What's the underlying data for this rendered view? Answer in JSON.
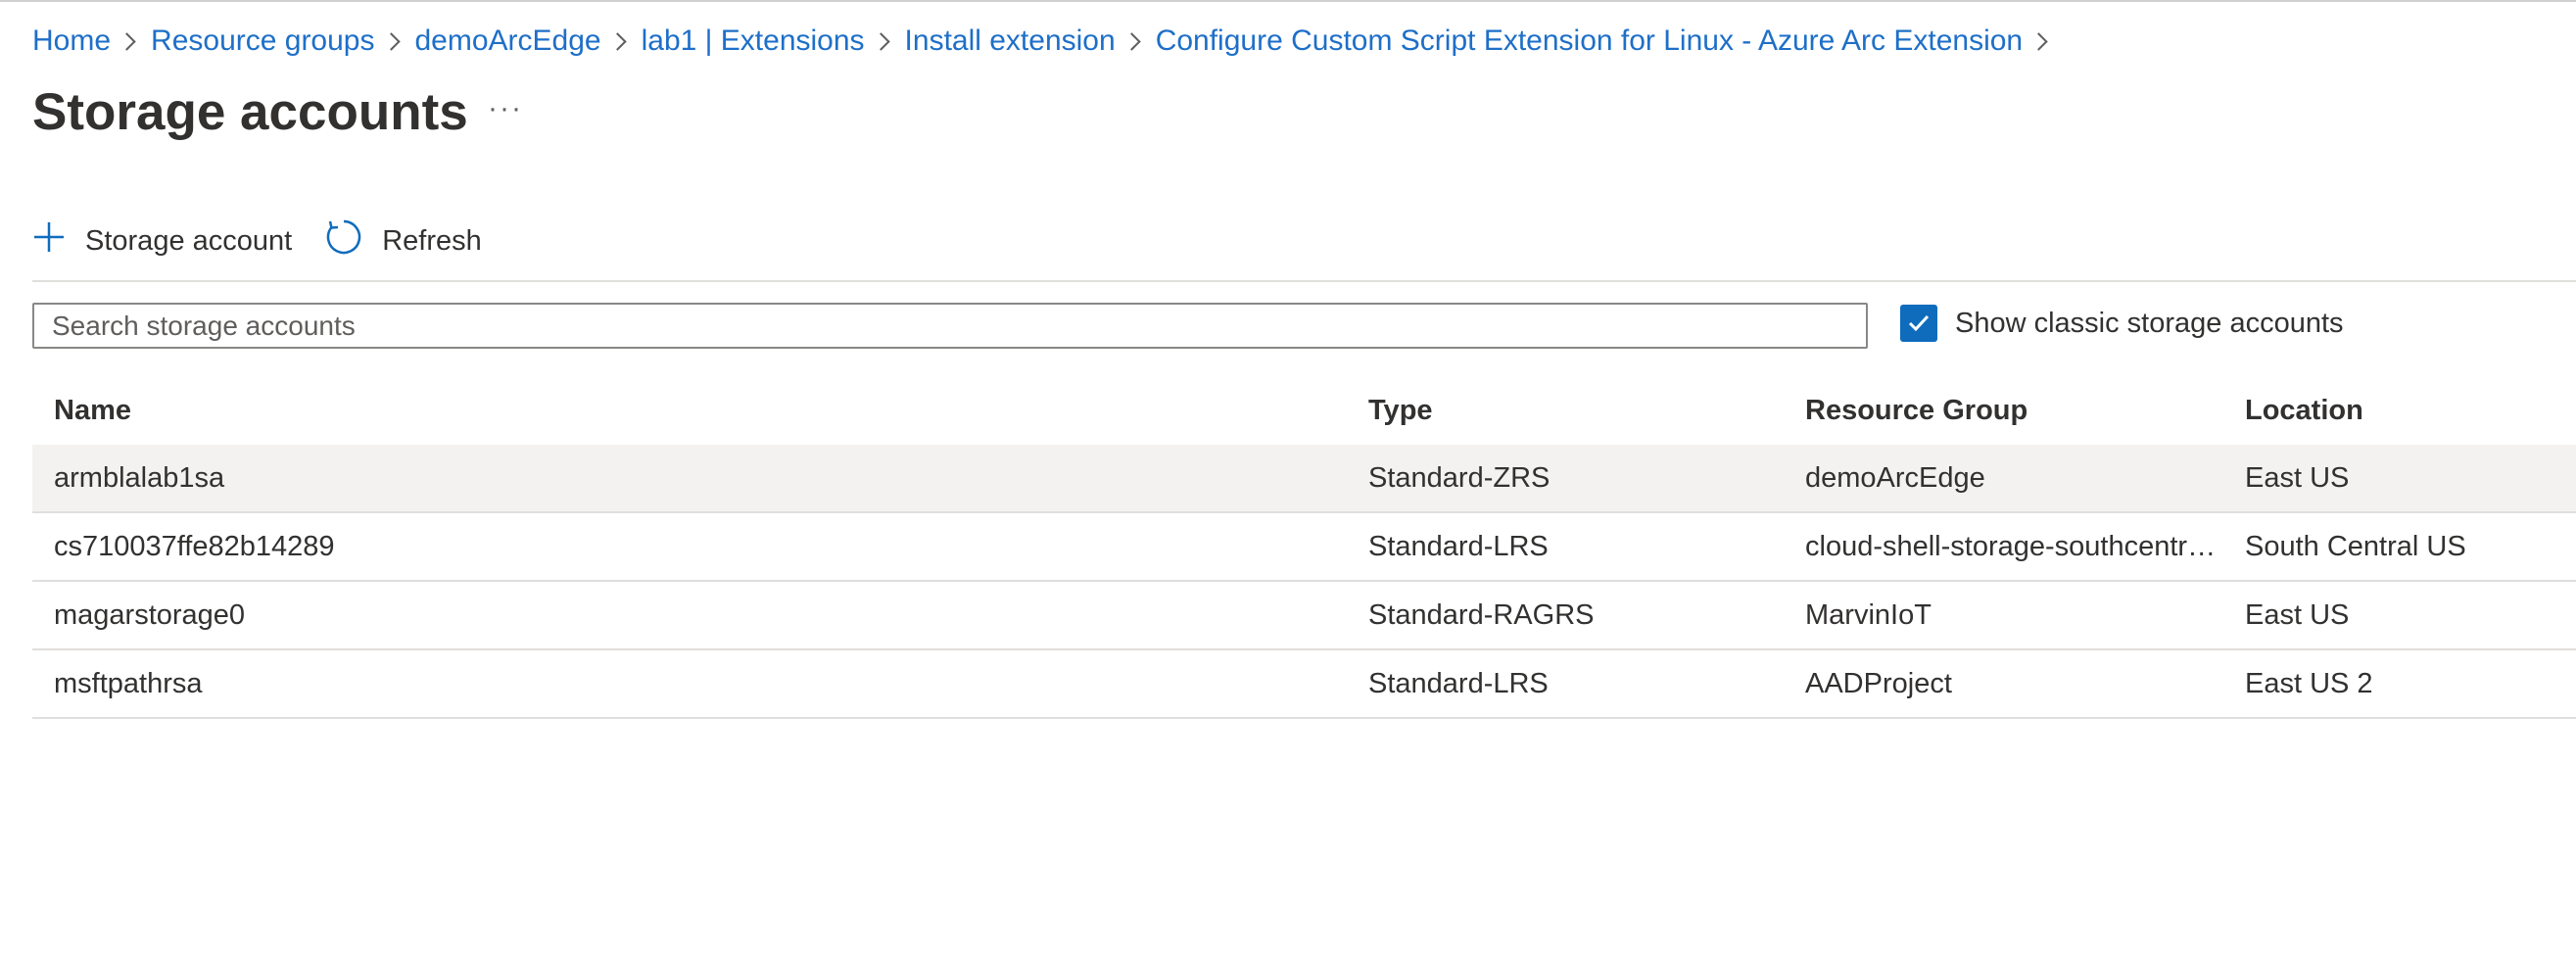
{
  "breadcrumb": [
    {
      "label": "Home"
    },
    {
      "label": "Resource groups"
    },
    {
      "label": "demoArcEdge"
    },
    {
      "label": "lab1 | Extensions"
    },
    {
      "label": "Install extension"
    },
    {
      "label": "Configure Custom Script Extension for Linux - Azure Arc Extension"
    }
  ],
  "page": {
    "title": "Storage accounts",
    "more_label": "···"
  },
  "toolbar": {
    "add_label": "Storage account",
    "add_icon": "plus-icon",
    "refresh_label": "Refresh",
    "refresh_icon": "refresh-icon"
  },
  "search": {
    "placeholder": "Search storage accounts",
    "value": ""
  },
  "show_classic": {
    "label": "Show classic storage accounts",
    "checked": true
  },
  "table": {
    "columns": [
      "Name",
      "Type",
      "Resource Group",
      "Location"
    ],
    "rows": [
      {
        "name": "armblalab1sa",
        "type": "Standard-ZRS",
        "resource_group": "demoArcEdge",
        "location": "East US"
      },
      {
        "name": "cs710037ffe82b14289",
        "type": "Standard-LRS",
        "resource_group": "cloud-shell-storage-southcentralus",
        "location": "South Central US"
      },
      {
        "name": "magarstorage0",
        "type": "Standard-RAGRS",
        "resource_group": "MarvinIoT",
        "location": "East US"
      },
      {
        "name": "msftpathrsa",
        "type": "Standard-LRS",
        "resource_group": "AADProject",
        "location": "East US 2"
      }
    ]
  },
  "colors": {
    "link": "#1e6fc8",
    "accent": "#0f6cbd",
    "selected_row": "#f3f2f1"
  }
}
